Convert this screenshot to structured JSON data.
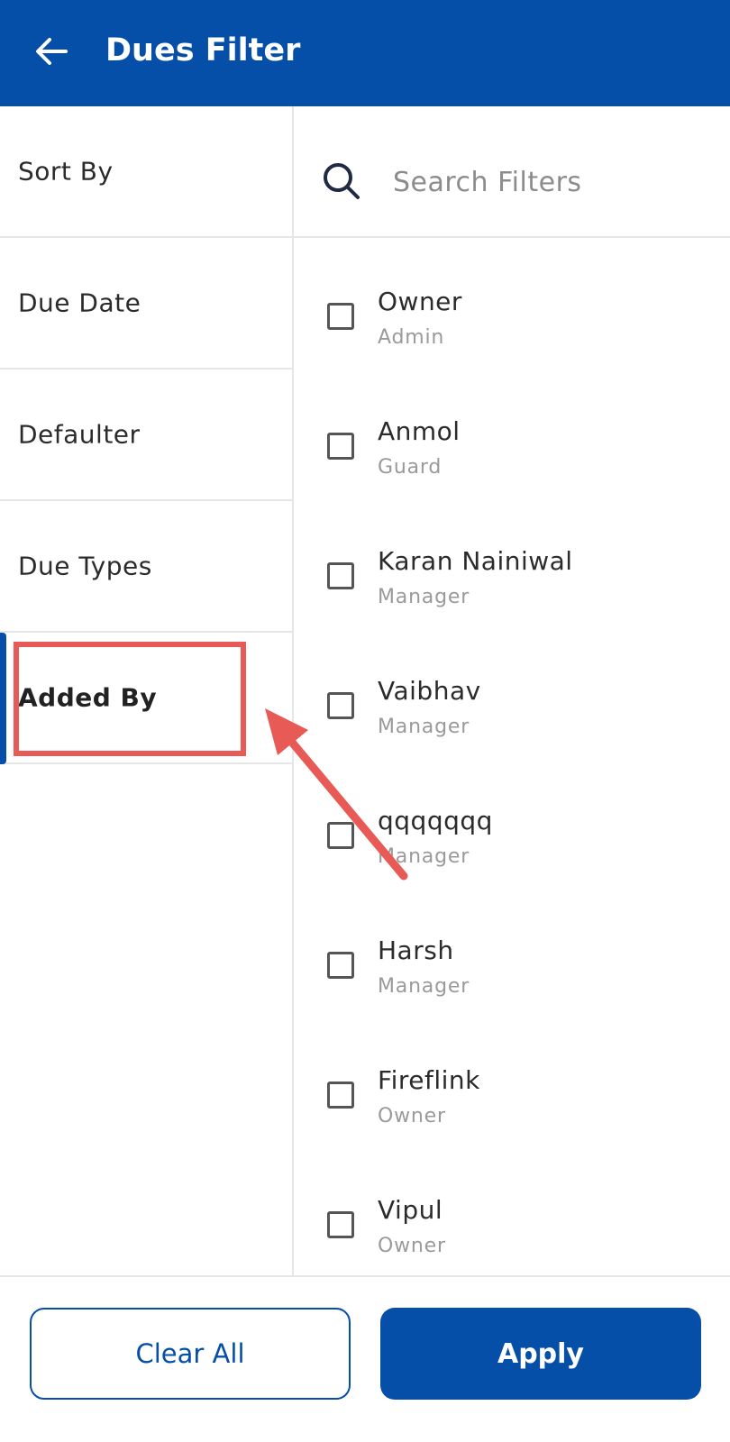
{
  "header": {
    "title": "Dues Filter",
    "back_icon": "arrow-left-icon",
    "background_color": "#054fa8"
  },
  "sidebar": {
    "items": [
      {
        "label": "Sort By"
      },
      {
        "label": "Due Date"
      },
      {
        "label": "Defaulter"
      },
      {
        "label": "Due Types"
      },
      {
        "label": "Added By",
        "active": true
      }
    ]
  },
  "search": {
    "icon": "search-icon",
    "placeholder": "Search Filters"
  },
  "options": [
    {
      "name": "Owner",
      "role": "Admin",
      "checked": false
    },
    {
      "name": "Anmol",
      "role": "Guard",
      "checked": false
    },
    {
      "name": "Karan Nainiwal",
      "role": "Manager",
      "checked": false
    },
    {
      "name": "Vaibhav",
      "role": "Manager",
      "checked": false
    },
    {
      "name": "qqqqqqq",
      "role": "Manager",
      "checked": false
    },
    {
      "name": "Harsh",
      "role": "Manager",
      "checked": false
    },
    {
      "name": "Fireflink",
      "role": "Owner",
      "checked": false
    },
    {
      "name": "Vipul",
      "role": "Owner",
      "checked": false
    }
  ],
  "footer": {
    "clear_label": "Clear All",
    "apply_label": "Apply"
  },
  "annotation": {
    "highlight_color": "#e85a55"
  }
}
